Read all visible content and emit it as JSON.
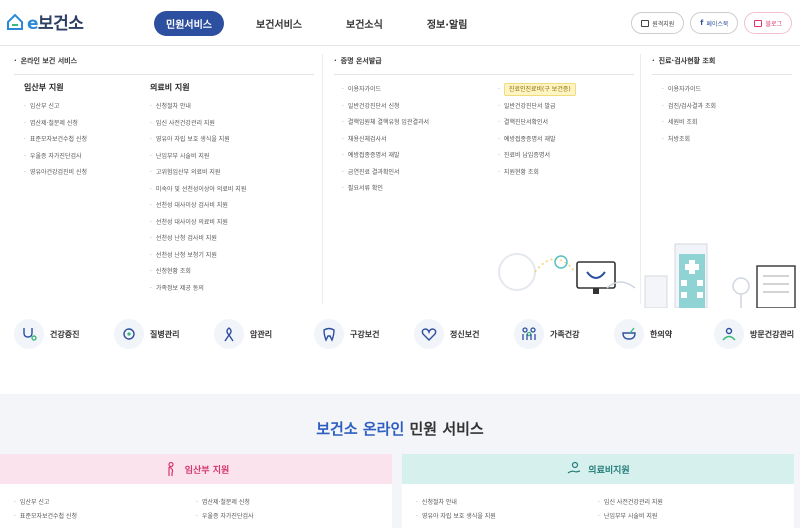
{
  "header": {
    "logo_e": "e",
    "logo_text": "보건소",
    "gnb": [
      {
        "label": "민원서비스",
        "active": true
      },
      {
        "label": "보건서비스",
        "active": false
      },
      {
        "label": "보건소식",
        "active": false
      },
      {
        "label": "정보·알림",
        "active": false
      }
    ],
    "buttons": [
      {
        "label": "원격지원",
        "icon": "monitor-icon"
      },
      {
        "label": "페이스북",
        "icon": "facebook-icon"
      },
      {
        "label": "블로그",
        "icon": "blog-icon"
      }
    ]
  },
  "mega": {
    "section_titles": [
      "온라인 보건 서비스",
      "증명 온서발급",
      "진료·검사현황 조회"
    ],
    "columns": [
      {
        "head": "임산부 지원",
        "items": [
          "임산부 신고",
          "엽산제·철분제 신청",
          "표준모자보건수첩 신청",
          "우울증 자가진단검사",
          "영유아건강검진비 신청"
        ]
      },
      {
        "head": "의료비 지원",
        "items": [
          "신청절차 안내",
          "임신 사전건강관리 지원",
          "영유아 자립 보호 생식을 지원",
          "난임부부 시술비 지원",
          "고위험임산부 의료비 지원",
          "미숙아 및 선천성이상아 의료비 지원",
          "선천성 대사이상 검사비 지원",
          "선천성 대사이상 의료비 지원",
          "선천성 난청 검사비 지원",
          "선천성 난청 보청기 지원",
          "신청현황 조회",
          "가족정보 제공 동의"
        ]
      },
      {
        "head": "",
        "items": [
          "이용자가이드",
          "일반건강진단서 신청",
          "결핵임원체 결핵유형 임관결과서",
          "채용신체검사서",
          "예방접종증명서 재발",
          "금연진료 결과확인서",
          "필요서류 확인"
        ]
      },
      {
        "head": "",
        "items": [
          "진료인진료비(구 보건증)",
          "일반건강진단서 발급",
          "결핵진단서확인서",
          "예방접종증명서 재발",
          "진료비 납입증명서",
          "지원현황 조회"
        ]
      },
      {
        "head": "",
        "items": [
          "이용자가이드",
          "검진/검사결과 조회",
          "세원비 조회",
          "처방조회"
        ]
      }
    ]
  },
  "categories": [
    {
      "label": "건강증진",
      "icon": "stethoscope-icon"
    },
    {
      "label": "질병관리",
      "icon": "virus-icon"
    },
    {
      "label": "암관리",
      "icon": "ribbon-icon"
    },
    {
      "label": "구강보건",
      "icon": "tooth-icon"
    },
    {
      "label": "정신보건",
      "icon": "heart-icon"
    },
    {
      "label": "가족건강",
      "icon": "family-icon"
    },
    {
      "label": "한의약",
      "icon": "mortar-icon"
    },
    {
      "label": "방문건강관리",
      "icon": "visit-care-icon"
    }
  ],
  "bottom": {
    "title_blue": "보건소 온라인",
    "title_rest": " 민원 서비스",
    "cards": [
      {
        "title": "임산부 지원",
        "icon": "pregnant-icon",
        "left": [
          "임산부 신고",
          "표준모자보건수첩 신청"
        ],
        "right": [
          "엽산제·철분제 신청",
          "우울증 자가진단검사"
        ]
      },
      {
        "title": "의료비지원",
        "icon": "hand-coin-icon",
        "left": [
          "신청절차 안내",
          "영유아 자립 보호 생식을 지원"
        ],
        "right": [
          "임신 사전건강관리 지원",
          "난임부부 시술비 지원"
        ]
      }
    ]
  },
  "colors": {
    "brand_navy": "#2d3e63",
    "active_tab": "#2d4fa0",
    "pink_card": "#fbe3ee",
    "mint_card": "#d6f0ee",
    "highlight": "#fff4c4"
  }
}
